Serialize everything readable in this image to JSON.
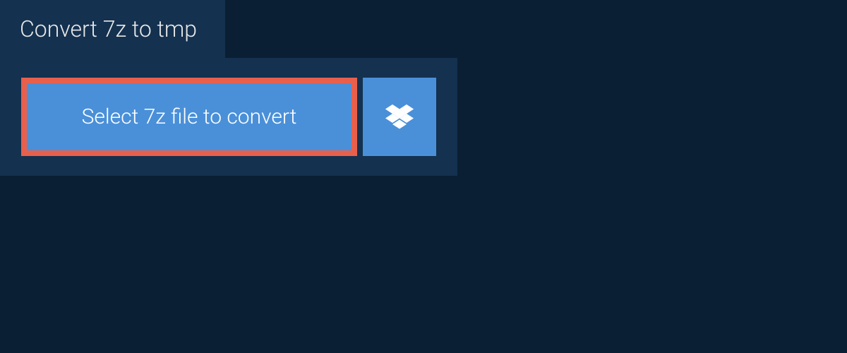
{
  "tab": {
    "title": "Convert 7z to tmp"
  },
  "actions": {
    "select_file_label": "Select 7z file to convert"
  },
  "colors": {
    "background_dark": "#0a1f33",
    "panel": "#14314f",
    "button_primary": "#4a90d9",
    "highlight_border": "#e8604c",
    "text_light": "#ffffff"
  }
}
